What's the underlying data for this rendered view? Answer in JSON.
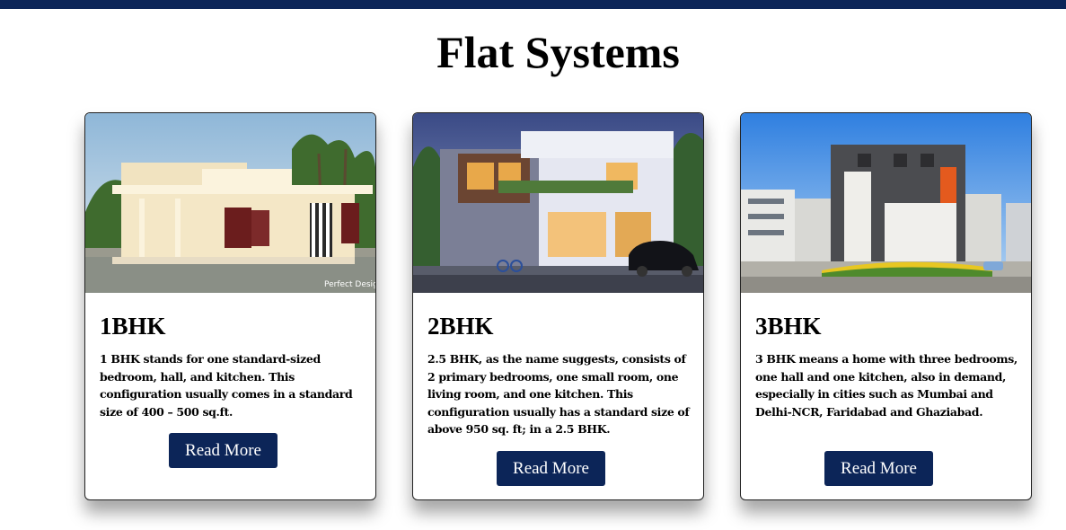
{
  "page": {
    "title": "Flat Systems"
  },
  "cards": [
    {
      "title": "1BHK",
      "description": "1 BHK stands for one standard-sized bedroom, hall, and kitchen. This configuration usually comes in a standard size of 400 – 500 sq.ft.",
      "button_label": "Read More",
      "watermark": "Perfect Design"
    },
    {
      "title": "2BHK",
      "description": "2.5 BHK, as the name suggests, consists of 2 primary bedrooms, one small room, one living room, and one kitchen. This configuration usually has a standard size of above 950 sq. ft; in a 2.5 BHK.",
      "button_label": "Read More"
    },
    {
      "title": "3BHK",
      "description": "3 BHK means a home with three bedrooms, one hall and one kitchen, also in demand, especially in cities such as Mumbai and Delhi-NCR, Faridabad and Ghaziabad.",
      "button_label": "Read More"
    }
  ],
  "colors": {
    "accent": "#0c2558",
    "button_text": "#ffffff"
  }
}
